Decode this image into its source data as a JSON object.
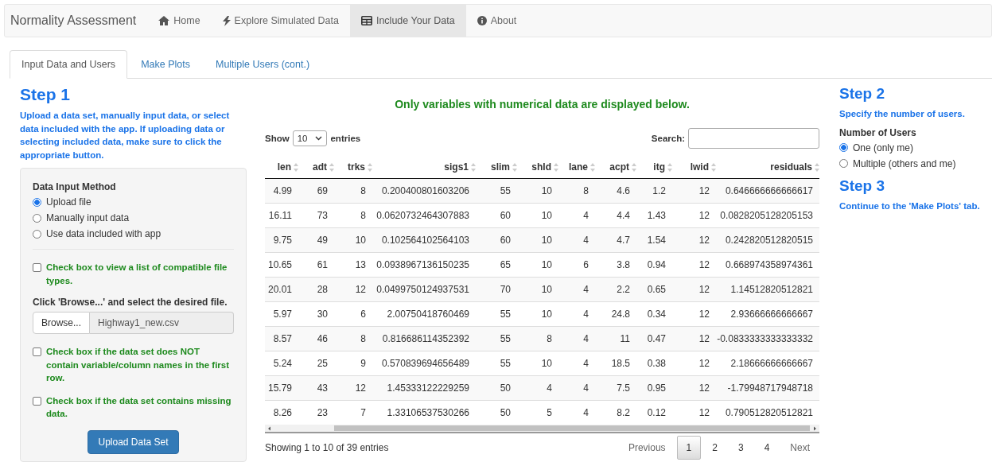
{
  "navbar": {
    "brand": "Normality Assessment",
    "items": [
      {
        "label": "Home",
        "kind": "home",
        "selected": false
      },
      {
        "label": "Explore Simulated Data",
        "kind": "explore",
        "selected": false
      },
      {
        "label": "Include Your Data",
        "kind": "data",
        "selected": true
      },
      {
        "label": "About",
        "kind": "about",
        "selected": false
      }
    ]
  },
  "tabs": [
    {
      "label": "Input Data and Users",
      "selected": true
    },
    {
      "label": "Make Plots",
      "selected": false
    },
    {
      "label": "Multiple Users (cont.)",
      "selected": false
    }
  ],
  "step1": {
    "title": "Step 1",
    "description": "Upload a data set, manually input data, or select data included with the app. If uploading data or selecting included data, make sure to click the appropriate button.",
    "panel": {
      "method_label": "Data Input Method",
      "methods": [
        {
          "label": "Upload file",
          "selected": true
        },
        {
          "label": "Manually input data",
          "selected": false
        },
        {
          "label": "Use data included with app",
          "selected": false
        }
      ],
      "file_types_check": {
        "label": "Check box to view a list of compatible file types.",
        "checked": false
      },
      "browse_label": "Click 'Browse...' and select the desired file.",
      "browse_button": "Browse...",
      "file_name": "Highway1_new.csv",
      "checks": [
        {
          "label": "Check box if the data set does NOT contain variable/column names in the first row.",
          "checked": false
        },
        {
          "label": "Check box if the data set contains missing data.",
          "checked": false
        }
      ],
      "upload_button": "Upload Data Set"
    }
  },
  "center": {
    "heading": "Only variables with numerical data are displayed below.",
    "show_label": "Show",
    "entries_value": "10",
    "entries_label": "entries",
    "search_label": "Search:",
    "table": {
      "columns": [
        "len",
        "adt",
        "trks",
        "sigs1",
        "slim",
        "shld",
        "lane",
        "acpt",
        "itg",
        "lwid",
        "residuals"
      ],
      "rows": [
        [
          "4.99",
          "69",
          "8",
          "0.200400801603206",
          "55",
          "10",
          "8",
          "4.6",
          "1.2",
          "12",
          "0.646666666666617"
        ],
        [
          "16.11",
          "73",
          "8",
          "0.0620732464307883",
          "60",
          "10",
          "4",
          "4.4",
          "1.43",
          "12",
          "0.0828205128205153"
        ],
        [
          "9.75",
          "49",
          "10",
          "0.102564102564103",
          "60",
          "10",
          "4",
          "4.7",
          "1.54",
          "12",
          "0.242820512820515"
        ],
        [
          "10.65",
          "61",
          "13",
          "0.0938967136150235",
          "65",
          "10",
          "6",
          "3.8",
          "0.94",
          "12",
          "0.668974358974361"
        ],
        [
          "20.01",
          "28",
          "12",
          "0.0499750124937531",
          "70",
          "10",
          "4",
          "2.2",
          "0.65",
          "12",
          "1.14512820512821"
        ],
        [
          "5.97",
          "30",
          "6",
          "2.00750418760469",
          "55",
          "10",
          "4",
          "24.8",
          "0.34",
          "12",
          "2.93666666666667"
        ],
        [
          "8.57",
          "46",
          "8",
          "0.816686114352392",
          "55",
          "8",
          "4",
          "11",
          "0.47",
          "12",
          "-0.0833333333333332"
        ],
        [
          "5.24",
          "25",
          "9",
          "0.570839694656489",
          "55",
          "10",
          "4",
          "18.5",
          "0.38",
          "12",
          "2.18666666666667"
        ],
        [
          "15.79",
          "43",
          "12",
          "1.45333122229259",
          "50",
          "4",
          "4",
          "7.5",
          "0.95",
          "12",
          "-1.79948717948718"
        ],
        [
          "8.26",
          "23",
          "7",
          "1.33106537530266",
          "50",
          "5",
          "4",
          "8.2",
          "0.12",
          "12",
          "0.790512820512821"
        ]
      ]
    },
    "info": "Showing 1 to 10 of 39 entries",
    "pagination": [
      {
        "label": "Previous",
        "kind": "nav",
        "selected": false
      },
      {
        "label": "1",
        "kind": "page",
        "selected": true
      },
      {
        "label": "2",
        "kind": "page",
        "selected": false
      },
      {
        "label": "3",
        "kind": "page",
        "selected": false
      },
      {
        "label": "4",
        "kind": "page",
        "selected": false
      },
      {
        "label": "Next",
        "kind": "nav",
        "selected": false
      }
    ]
  },
  "step2": {
    "title": "Step 2",
    "description": "Specify the number of users.",
    "users_label": "Number of Users",
    "options": [
      {
        "label": "One (only me)",
        "selected": true
      },
      {
        "label": "Multiple (others and me)",
        "selected": false
      }
    ]
  },
  "step3": {
    "title": "Step 3",
    "description": "Continue to the 'Make Plots' tab."
  }
}
